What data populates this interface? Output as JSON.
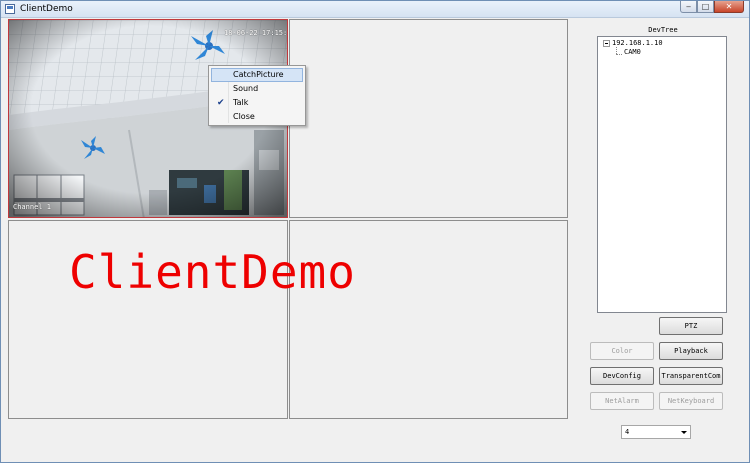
{
  "window": {
    "title": "ClientDemo",
    "minimize_label": "‒",
    "maximize_label": "□",
    "close_label": "✕"
  },
  "video": {
    "watermark": "ClientDemo",
    "channel1": {
      "osd_time": "18-06-22 17:15:4",
      "osd_name": "Channel 1"
    }
  },
  "context_menu": {
    "items": [
      {
        "label": "CatchPicture",
        "checked": false,
        "hover": true
      },
      {
        "label": "Sound",
        "checked": false,
        "hover": false
      },
      {
        "label": "Talk",
        "checked": true,
        "hover": false
      },
      {
        "label": "Close",
        "checked": false,
        "hover": false
      }
    ]
  },
  "devtree": {
    "label": "DevTree",
    "device": "192.168.1.10",
    "channel": "CAM0"
  },
  "buttons": {
    "ptz": "PTZ",
    "color": "Color",
    "playback": "Playback",
    "devconfig": "DevConfig",
    "transparentcom": "TransparentCom",
    "netalarm": "NetAlarm",
    "netkeyboard": "NetKeyboard"
  },
  "split_select": {
    "value": "4"
  }
}
